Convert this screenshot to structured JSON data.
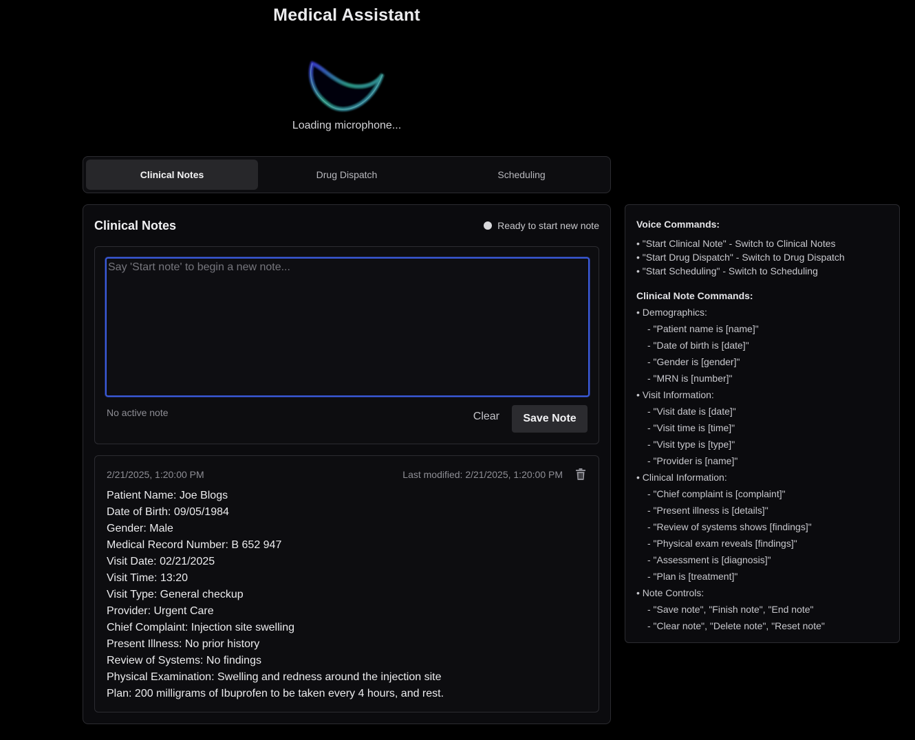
{
  "app": {
    "title": "Medical Assistant",
    "mic_status": "Loading microphone..."
  },
  "tabs": [
    {
      "label": "Clinical Notes",
      "active": true
    },
    {
      "label": "Drug Dispatch",
      "active": false
    },
    {
      "label": "Scheduling",
      "active": false
    }
  ],
  "notes_panel": {
    "title": "Clinical Notes",
    "status": "Ready to start new note",
    "input_placeholder": "Say 'Start note' to begin a new note...",
    "input_value": "",
    "active_note_text": "No active note",
    "clear_label": "Clear",
    "save_label": "Save Note"
  },
  "saved_note": {
    "created": "2/21/2025, 1:20:00 PM",
    "modified": "Last modified: 2/21/2025, 1:20:00 PM",
    "lines": [
      "Patient Name: Joe Blogs",
      "Date of Birth: 09/05/1984",
      "Gender: Male",
      "Medical Record Number: B 652 947",
      "Visit Date: 02/21/2025",
      "Visit Time: 13:20",
      "Visit Type: General checkup",
      "Provider: Urgent Care",
      "Chief Complaint: Injection site swelling",
      "Present Illness: No prior history",
      "Review of Systems: No findings",
      "Physical Examination: Swelling and redness around the injection site",
      "Plan: 200 milligrams of Ibuprofen to be taken every 4 hours, and rest."
    ]
  },
  "help": {
    "voice_heading": "Voice Commands:",
    "voice_items": [
      "• \"Start Clinical Note\" - Switch to Clinical Notes",
      "• \"Start Drug Dispatch\" - Switch to Drug Dispatch",
      "• \"Start Scheduling\" - Switch to Scheduling"
    ],
    "clinical_heading": "Clinical Note Commands:",
    "demographics": {
      "title": "• Demographics:",
      "items": [
        "- \"Patient name is [name]\"",
        "- \"Date of birth is [date]\"",
        "- \"Gender is [gender]\"",
        "- \"MRN is [number]\""
      ]
    },
    "visit": {
      "title": "• Visit Information:",
      "items": [
        "- \"Visit date is [date]\"",
        "- \"Visit time is [time]\"",
        "- \"Visit type is [type]\"",
        "- \"Provider is [name]\""
      ]
    },
    "clinical": {
      "title": "• Clinical Information:",
      "items": [
        "- \"Chief complaint is [complaint]\"",
        "- \"Present illness is [details]\"",
        "- \"Review of systems shows [findings]\"",
        "- \"Physical exam reveals [findings]\"",
        "- \"Assessment is [diagnosis]\"",
        "- \"Plan is [treatment]\""
      ]
    },
    "controls": {
      "title": "• Note Controls:",
      "items": [
        "- \"Save note\", \"Finish note\", \"End note\"",
        "- \"Clear note\", \"Delete note\", \"Reset note\""
      ]
    }
  },
  "colors": {
    "background": "#000000",
    "panel": "#0b0b0e",
    "focus_ring": "#3b5bdb",
    "active_tab": "#27272a"
  },
  "icons": {
    "mic_orb": "mic-visualizer-orb",
    "delete": "trash-icon",
    "status": "status-dot"
  }
}
